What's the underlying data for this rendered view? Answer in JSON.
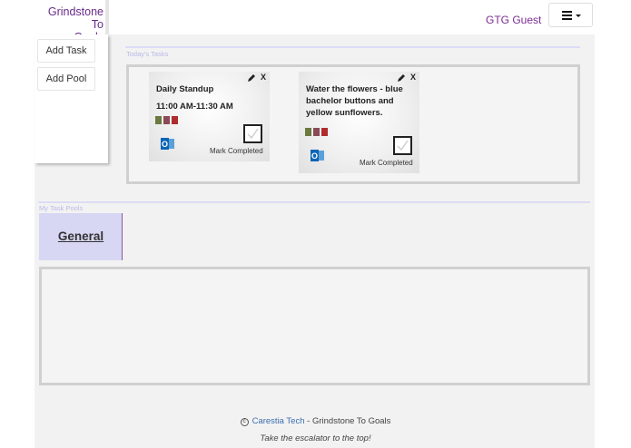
{
  "header": {
    "brand_line1": "Grindstone To",
    "brand_line2": "Goals",
    "user_name": "GTG Guest",
    "menu_icon": "hamburger-icon"
  },
  "sidebar": {
    "add_task_label": "Add Task",
    "add_pool_label": "Add Pool"
  },
  "today": {
    "label": "Today's Tasks",
    "tasks": [
      {
        "title": "Daily Standup",
        "time": "11:00 AM-11:30 AM",
        "colors": [
          "#6b7a3e",
          "#8a4a57",
          "#b02c2c"
        ],
        "mark_label": "Mark Completed",
        "close_label": "X"
      },
      {
        "title": "Water the flowers - blue bachelor buttons and yellow sunflowers.",
        "time": "",
        "colors": [
          "#6b7a3e",
          "#8a4a57",
          "#b02c2c"
        ],
        "mark_label": "Mark Completed",
        "close_label": "X"
      }
    ]
  },
  "pools": {
    "label": "My Task Pools",
    "tabs": [
      {
        "label": "General"
      }
    ]
  },
  "footer": {
    "copyright_symbol": "c",
    "company_link": "Carestia Tech",
    "suffix": " - Grindstone To Goals",
    "tagline": "Take the escalator to the top!"
  }
}
